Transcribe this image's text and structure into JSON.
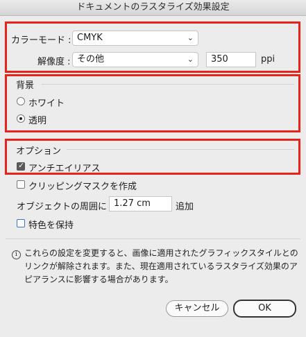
{
  "window": {
    "title": "ドキュメントのラスタライズ効果設定"
  },
  "color_mode": {
    "label": "カラーモード :",
    "value": "CMYK"
  },
  "resolution": {
    "label": "解像度 :",
    "value": "その他",
    "ppi_value": "350",
    "unit": "ppi"
  },
  "background": {
    "title": "背景",
    "options": [
      {
        "label": "ホワイト",
        "selected": false
      },
      {
        "label": "透明",
        "selected": true
      }
    ]
  },
  "options": {
    "title": "オプション",
    "antialias": {
      "label": "アンチエイリアス",
      "checked": true
    },
    "clipping_mask": {
      "label": "クリッピングマスクを作成",
      "checked": false
    },
    "surround": {
      "label": "オブジェクトの周囲に",
      "value": "1.27 cm",
      "suffix": "追加"
    },
    "spot_color": {
      "label": "特色を保持",
      "checked": false
    }
  },
  "info": {
    "icon": "info-icon",
    "text_line1": "これらの設定を変更すると、画像に適用されたグラフィックスタイルとの",
    "text_line2": "リンクが解除されます。また、現在適用されているラスタライズ効果のア",
    "text_line3": "ピアランスに影響する場合があります。"
  },
  "buttons": {
    "cancel": "キャンセル",
    "ok": "OK"
  },
  "highlight_color": "#e8231a"
}
